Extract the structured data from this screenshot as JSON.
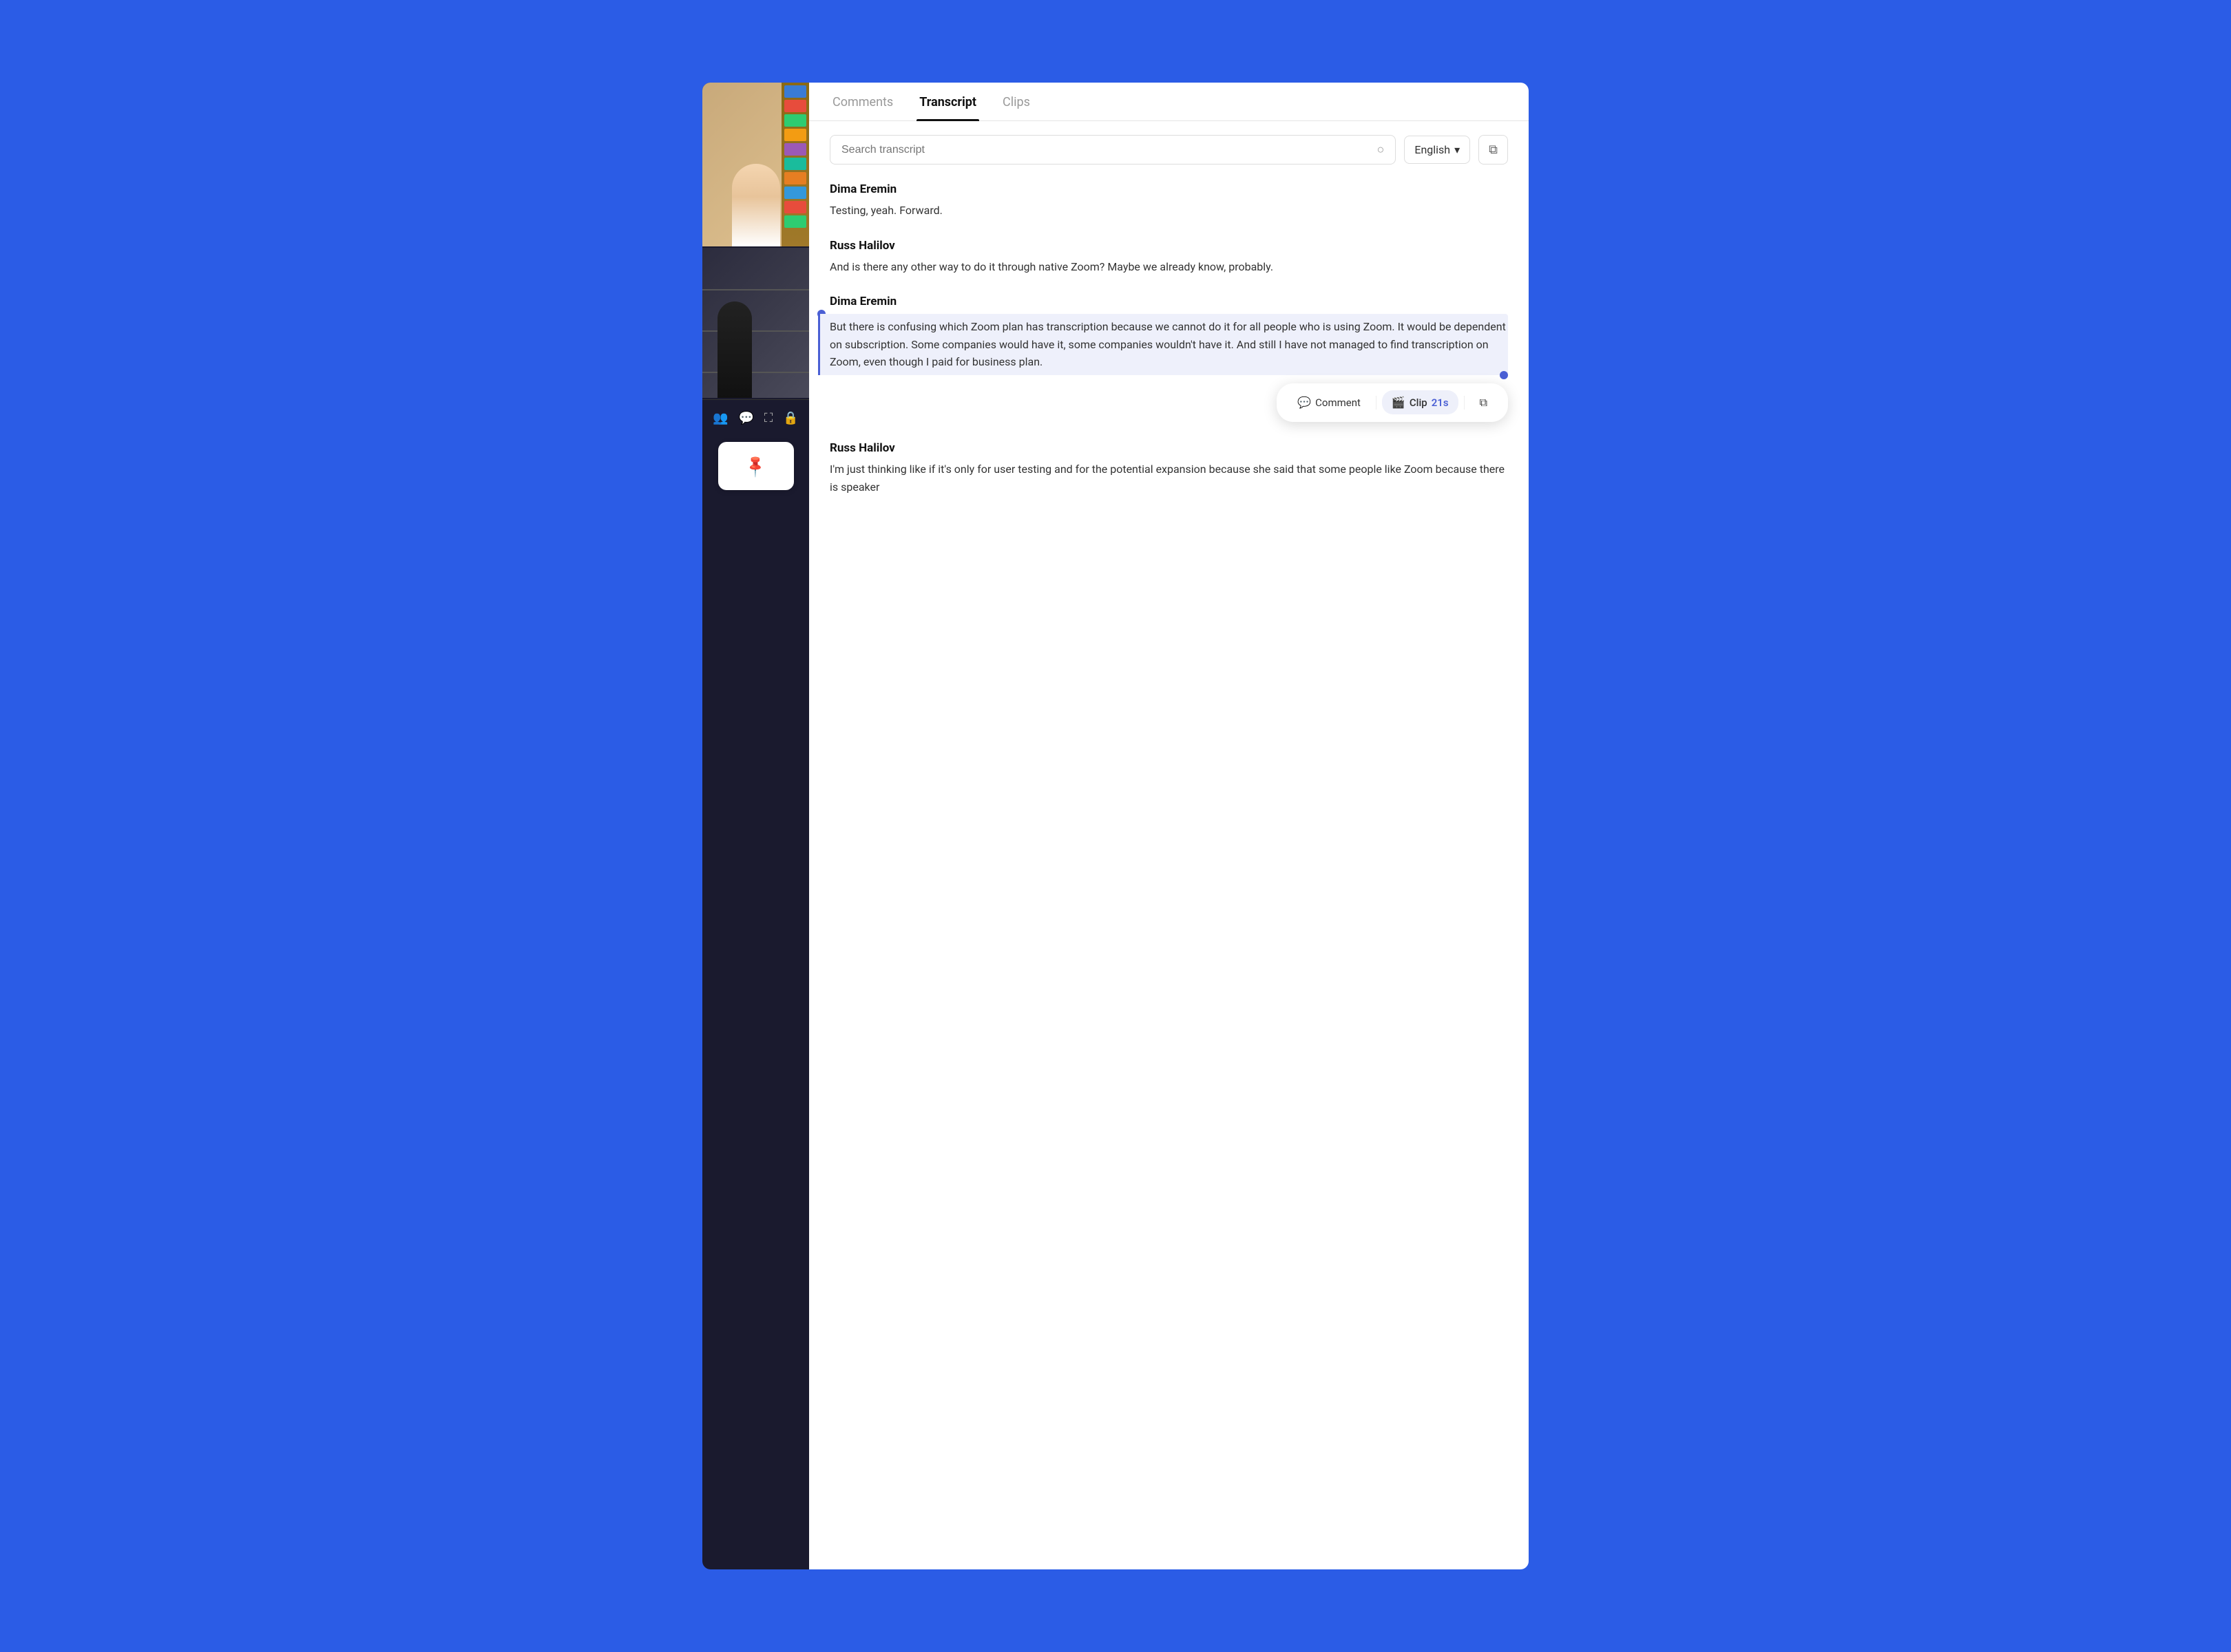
{
  "tabs": [
    {
      "id": "comments",
      "label": "Comments",
      "active": false
    },
    {
      "id": "transcript",
      "label": "Transcript",
      "active": true
    },
    {
      "id": "clips",
      "label": "Clips",
      "active": false
    }
  ],
  "search": {
    "placeholder": "Search transcript",
    "value": ""
  },
  "language": {
    "selected": "English",
    "chevron": "▾"
  },
  "transcript": [
    {
      "id": "block-1",
      "speaker": "Dima Eremin",
      "text": "Testing, yeah. Forward.",
      "selected": false
    },
    {
      "id": "block-2",
      "speaker": "Russ Halilov",
      "text": "And is there any other way to do it through native Zoom? Maybe we already know, probably.",
      "selected": false
    },
    {
      "id": "block-3",
      "speaker": "Dima Eremin",
      "text": "But there is confusing which Zoom plan has transcription because we cannot do it for all people who is using Zoom. It would be dependent on subscription. Some companies would have it, some companies wouldn't have it. And still I have not managed to find transcription on Zoom, even though I paid for business plan.",
      "selected": true
    },
    {
      "id": "block-4",
      "speaker": "Russ Halilov",
      "text": "I'm just thinking like if it's only for user testing and for the potential expansion because she said that some people like Zoom because there is speaker",
      "selected": false
    }
  ],
  "actionBar": {
    "commentLabel": "Comment",
    "clipLabel": "Clip",
    "clipDuration": "21s",
    "icons": {
      "comment": "💬",
      "clip": "🎬",
      "copy": "⧉"
    }
  },
  "sidebar": {
    "icons": [
      {
        "name": "participants-icon",
        "symbol": "👥"
      },
      {
        "name": "chat-icon",
        "symbol": "💬"
      },
      {
        "name": "structure-icon",
        "symbol": "⛶"
      },
      {
        "name": "lock-icon",
        "symbol": "🔒"
      }
    ],
    "pinButtonLabel": "📌"
  }
}
